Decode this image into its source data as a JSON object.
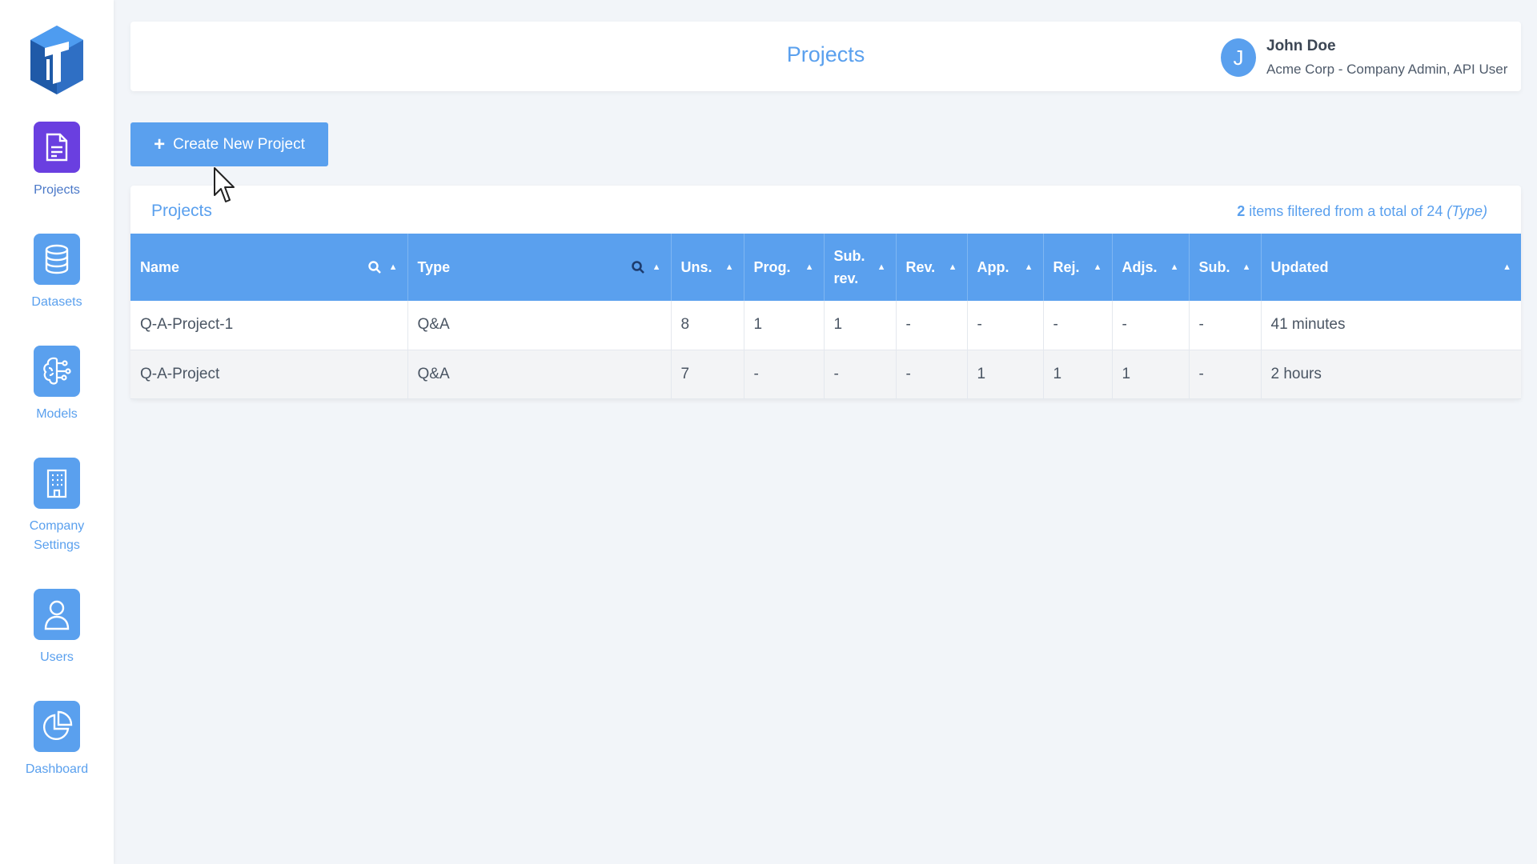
{
  "sidebar": {
    "items": [
      {
        "label": "Projects",
        "icon": "document-icon",
        "active": true
      },
      {
        "label": "Datasets",
        "icon": "database-icon",
        "active": false
      },
      {
        "label": "Models",
        "icon": "brain-circuit-icon",
        "active": false
      },
      {
        "label": "Company Settings",
        "icon": "building-icon",
        "active": false
      },
      {
        "label": "Users",
        "icon": "user-icon",
        "active": false
      },
      {
        "label": "Dashboard",
        "icon": "pie-chart-icon",
        "active": false
      }
    ]
  },
  "header": {
    "title": "Projects",
    "user": {
      "initial": "J",
      "name": "John Doe",
      "role": "Acme Corp - Company Admin, API User"
    }
  },
  "toolbar": {
    "create_label": "Create New Project"
  },
  "projects_card": {
    "title": "Projects",
    "filter": {
      "count": "2",
      "text": " items filtered from a total of 24 ",
      "filter_name": "(Type)"
    },
    "columns": [
      "Name",
      "Type",
      "Uns.",
      "Prog.",
      "Sub. rev.",
      "Rev.",
      "App.",
      "Rej.",
      "Adjs.",
      "Sub.",
      "Updated"
    ],
    "rows": [
      {
        "name": "Q-A-Project-1",
        "type": "Q&A",
        "uns": "8",
        "prog": "1",
        "subrev": "1",
        "rev": "-",
        "app": "-",
        "rej": "-",
        "adjs": "-",
        "sub": "-",
        "updated": "41 minutes"
      },
      {
        "name": "Q-A-Project",
        "type": "Q&A",
        "uns": "7",
        "prog": "-",
        "subrev": "-",
        "rev": "-",
        "app": "1",
        "rej": "1",
        "adjs": "1",
        "sub": "-",
        "updated": "2 hours"
      }
    ]
  },
  "colors": {
    "accent": "#5aa0ee",
    "active_nav": "#6a3fe0",
    "rejected": "#d9534f"
  }
}
